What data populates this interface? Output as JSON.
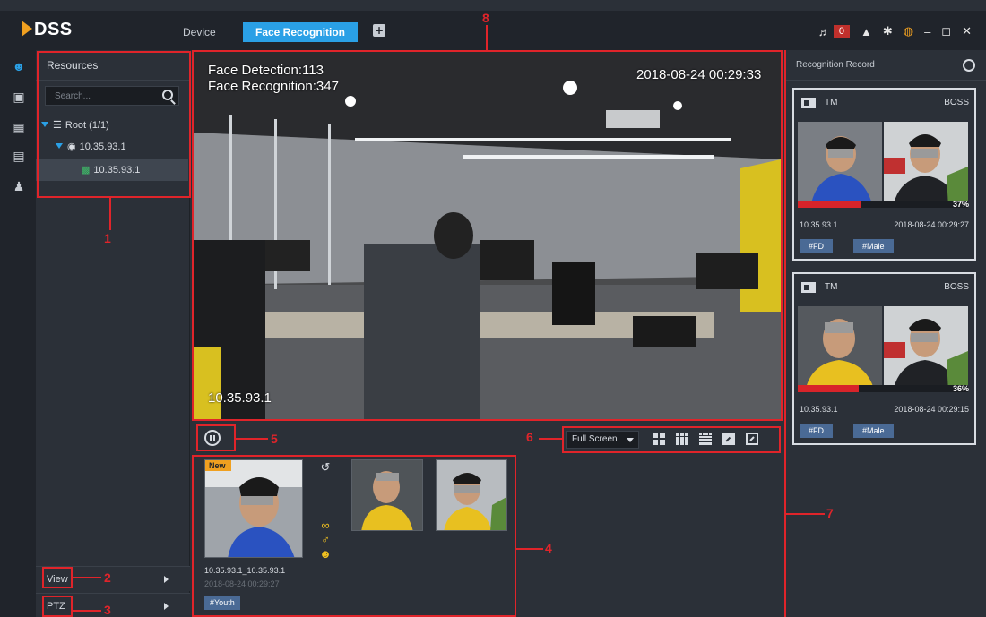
{
  "header": {
    "logo": "DSS",
    "tabs": [
      {
        "label": "Device"
      },
      {
        "label": "Face Recognition"
      }
    ],
    "add_tab": "+",
    "alarm_count": "0"
  },
  "resources": {
    "title": "Resources",
    "search_placeholder": "Search...",
    "tree": [
      {
        "label": "Root (1/1)"
      },
      {
        "label": "10.35.93.1"
      },
      {
        "label": "10.35.93.1"
      }
    ],
    "view_label": "View",
    "ptz_label": "PTZ"
  },
  "video": {
    "face_detection": "Face Detection:113",
    "face_recognition": "Face Recognition:347",
    "timestamp": "2018-08-24 00:29:33",
    "channel": "10.35.93.1"
  },
  "toolbar": {
    "screen_mode": "Full Screen"
  },
  "capture": {
    "new_tag": "New",
    "channel_text": "10.35.93.1_10.35.93.1",
    "time_text": "2018-08-24 00:29:27",
    "tag": "#Youth"
  },
  "records": {
    "title": "Recognition Record",
    "cards": [
      {
        "type": "TM",
        "group": "BOSS",
        "similarity": "37%",
        "similarity_value": 0.37,
        "ip": "10.35.93.1",
        "time": "2018-08-24 00:29:27",
        "tags": [
          "#FD",
          "#Male"
        ]
      },
      {
        "type": "TM",
        "group": "BOSS",
        "similarity": "36%",
        "similarity_value": 0.36,
        "ip": "10.35.93.1",
        "time": "2018-08-24 00:29:15",
        "tags": [
          "#FD",
          "#Male"
        ]
      }
    ]
  },
  "annotations": [
    "1",
    "2",
    "3",
    "4",
    "5",
    "6",
    "7",
    "8"
  ],
  "colors": {
    "accent": "#2aa0e6",
    "callout": "#e0242a",
    "panel": "#2b3038",
    "titlebar": "#20242b",
    "tag": "#4a6a95",
    "new_tag": "#f0a020",
    "similarity_bar": "#d8242a"
  }
}
